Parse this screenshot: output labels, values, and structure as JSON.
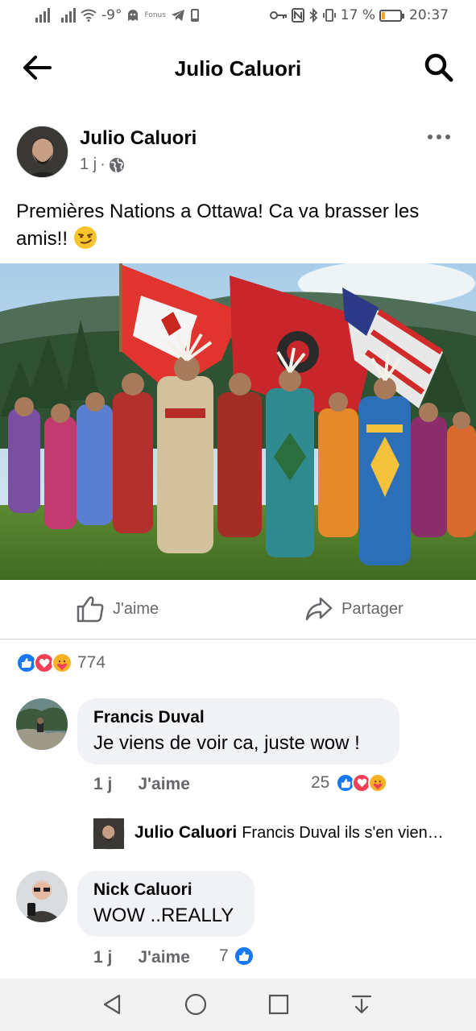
{
  "status_bar": {
    "temperature": "-9°",
    "carrier_small": "Fonus",
    "battery_percent": "17 %",
    "battery_level": 0.17,
    "time": "20:37"
  },
  "header": {
    "title": "Julio Caluori",
    "icons": [
      "back-arrow-icon",
      "search-icon"
    ]
  },
  "post": {
    "author": "Julio Caluori",
    "time": "1 j",
    "separator": "·",
    "text": "Premières Nations a Ottawa! Ca va brasser les amis!!",
    "emoji": "smirk-emoji"
  },
  "actions": {
    "like_label": "J'aime",
    "share_label": "Partager"
  },
  "reactions": {
    "count": "774",
    "types": [
      "like",
      "love",
      "care"
    ]
  },
  "comments": [
    {
      "name": "Francis Duval",
      "text": "Je viens de voir ca, juste wow !",
      "time": "1 j",
      "like_label": "J'aime",
      "reaction_count": "25",
      "reply": {
        "name": "Julio Caluori",
        "text": "Francis Duval ils s'en vien…"
      }
    },
    {
      "name": "Nick Caluori",
      "text": "WOW ..REALLY",
      "time": "1 j",
      "like_label": "J'aime",
      "reaction_count": "7"
    }
  ],
  "colors": {
    "facebook_blue": "#1877f2",
    "love_red": "#f33e58",
    "care_yellow": "#f7b125",
    "bubble_gray": "#f0f2f5",
    "secondary_text": "#65676b"
  }
}
